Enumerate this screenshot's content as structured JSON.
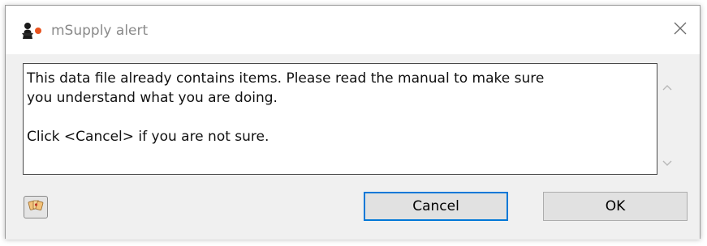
{
  "window": {
    "title": "mSupply alert"
  },
  "message": {
    "lines": [
      "This data file already contains items. Please read the manual to make sure",
      "you understand what you are doing.",
      "",
      "Click <Cancel> if you are not sure."
    ]
  },
  "buttons": {
    "cancel_label": "Cancel",
    "ok_label": "OK"
  },
  "colors": {
    "focus_border": "#0078d7",
    "button_bg": "#e1e1e1",
    "dialog_bg": "#f0f0f0"
  },
  "icons": {
    "app": "msupply-logo-icon",
    "close": "close-icon",
    "help": "help-cards-icon"
  }
}
